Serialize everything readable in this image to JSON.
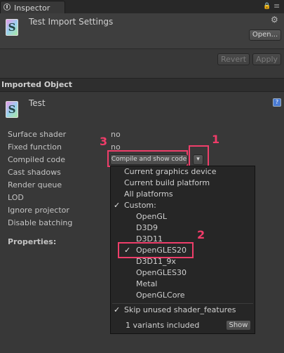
{
  "tab": {
    "label": "Inspector"
  },
  "tabbar": {
    "lock": "🔒",
    "menu": "≡"
  },
  "header": {
    "file_letter": "S",
    "title": "Test Import Settings",
    "settings": "⚙",
    "open_label": "Open...",
    "revert_label": "Revert",
    "apply_label": "Apply"
  },
  "section": {
    "title": "Imported Object"
  },
  "object": {
    "letter": "S",
    "name": "Test",
    "help": "?"
  },
  "properties": [
    {
      "label": "Surface shader",
      "value": "no"
    },
    {
      "label": "Fixed function",
      "value": "no"
    },
    {
      "label": "Compiled code",
      "value": "Compile and show code"
    },
    {
      "label": "Cast shadows"
    },
    {
      "label": "Render queue"
    },
    {
      "label": "LOD"
    },
    {
      "label": "Ignore projector"
    },
    {
      "label": "Disable batching"
    }
  ],
  "properties_title": "Properties:",
  "dropdown_arrow": "▾",
  "annotations": {
    "one": "1",
    "two": "2",
    "three": "3"
  },
  "menu": {
    "items": [
      "Current graphics device",
      "Current build platform",
      "All platforms",
      "Custom:",
      "OpenGL",
      "D3D9",
      "D3D11",
      "OpenGLES20",
      "D3D11_9x",
      "OpenGLES30",
      "Metal",
      "OpenGLCore",
      "Skip unused shader_features"
    ],
    "check": "✓",
    "variants_text": "1 variants included",
    "show_label": "Show"
  }
}
